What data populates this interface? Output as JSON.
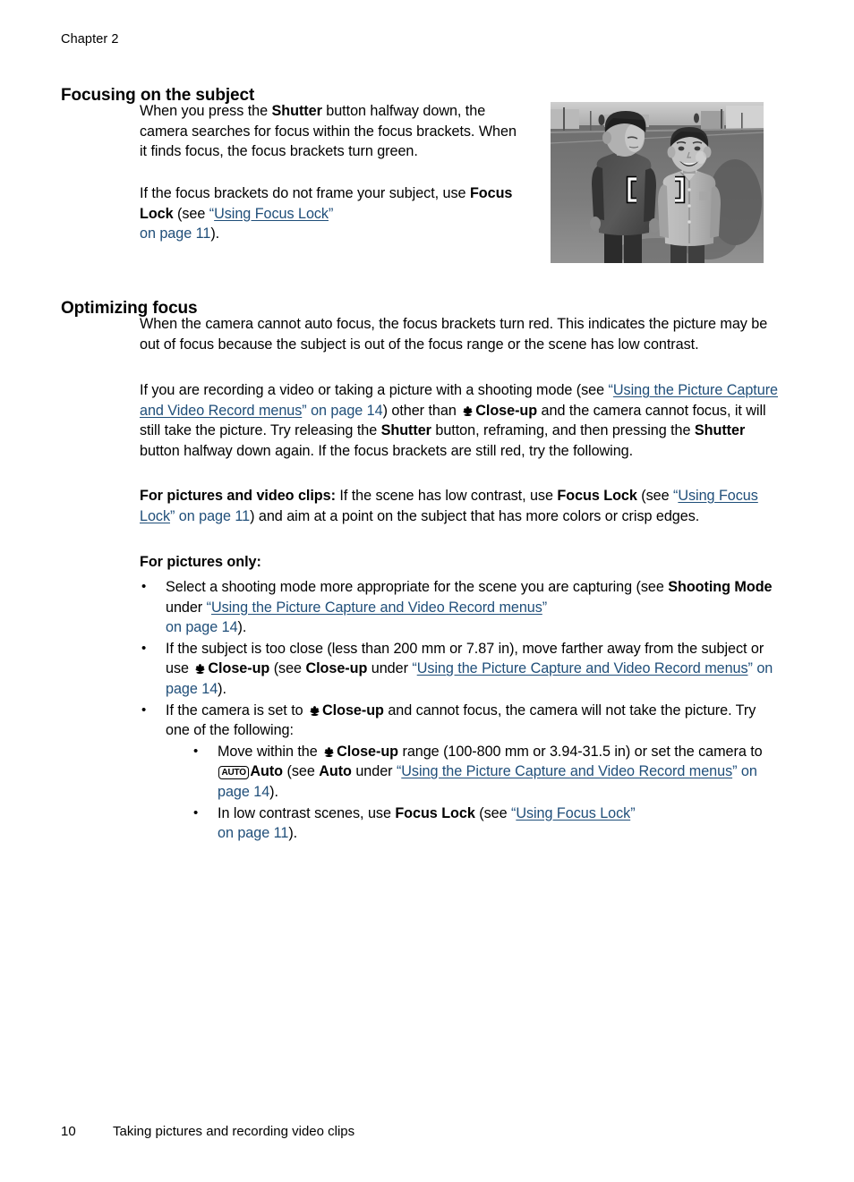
{
  "page": {
    "chapter_header": "Chapter 2",
    "footer_page_number": "10",
    "footer_title": "Taking pictures and recording video clips"
  },
  "sections": {
    "focusing": {
      "heading": "Focusing on the subject",
      "para1_a": "When you press the ",
      "para1_shutter": "Shutter",
      "para1_b": " button halfway down, the camera searches for focus within the focus brackets. When it finds focus, the focus brackets turn green.",
      "para2_a": "If the focus brackets do not frame your subject, use ",
      "para2_focuslock": "Focus Lock",
      "para2_b": " (see ",
      "para2_quote_open": "“",
      "para2_link": "Using Focus Lock",
      "para2_quote_close": "”",
      "para2_page": "on page 11",
      "para2_end": ")."
    },
    "optimizing": {
      "heading": "Optimizing focus",
      "para1": "When the camera cannot auto focus, the focus brackets turn red. This indicates the picture may be out of focus because the subject is out of the focus range or the scene has low contrast.",
      "para2_a": "If you are recording a video or taking a picture with a shooting mode (see ",
      "para2_quote_open": "“",
      "para2_link": "Using the Picture Capture and Video Record menus",
      "para2_quote_close": "”",
      "para2_page": " on page 14",
      "para2_b": ") other than ",
      "para2_closeup": "Close-up",
      "para2_c": " and the camera cannot focus, it will still take the picture. Try releasing the ",
      "para2_shutter1": "Shutter",
      "para2_d": " button, reframing, and then pressing the ",
      "para2_shutter2": "Shutter",
      "para2_e": " button halfway down again. If the focus brackets are still red, try the following.",
      "para3_label": "For pictures and video clips:",
      "para3_a": " If the scene has low contrast, use ",
      "para3_focuslock": "Focus Lock",
      "para3_b": " (see ",
      "para3_quote_open": "“",
      "para3_link": "Using Focus Lock",
      "para3_quote_close": "”",
      "para3_page": " on page 11",
      "para3_c": ") and aim at a point on the subject that has more colors or crisp edges.",
      "para4_label": "For pictures only:"
    }
  },
  "bullets": [
    {
      "bullet": "•",
      "a": "Select a shooting mode more appropriate for the scene you are capturing (see ",
      "bold1": "Shooting Mode",
      "b": " under ",
      "quote_open": "“",
      "link": "Using the Picture Capture and Video Record menus",
      "quote_close": "”",
      "page": "on page 14",
      "end": ")."
    },
    {
      "bullet": "•",
      "a": "If the subject is too close (less than 200 mm or 7.87 in), move farther away from the subject or use ",
      "closeup1": "Close-up",
      "b": " (see ",
      "closeup2": "Close-up",
      "c": " under ",
      "quote_open": "“",
      "link": "Using the Picture Capture and Video Record menus",
      "quote_close": "”",
      "page": " on page 14",
      "end": ")."
    },
    {
      "bullet": "•",
      "a": "If the camera is set to ",
      "closeup1": "Close-up",
      "b": " and cannot focus, the camera will not take the picture. Try one of the following:",
      "sub": [
        {
          "bullet": "•",
          "a": "Move within the ",
          "closeup1": "Close-up",
          "b": " range (100-800 mm or 3.94-31.5 in) or set the camera to ",
          "auto_icon_label": "AUTO",
          "auto_bold": "Auto",
          "c": " (see ",
          "auto_bold2": "Auto",
          "d": " under ",
          "quote_open": "“",
          "link": "Using the Picture Capture and Video Record menus",
          "quote_close": "”",
          "page": " on page 14",
          "end": ")."
        },
        {
          "bullet": "•",
          "a": "In low contrast scenes, use ",
          "focuslock": "Focus Lock",
          "b": " (see ",
          "quote_open": "“",
          "link": "Using Focus Lock",
          "quote_close": "”",
          "page": "on page 11",
          "end": ")."
        }
      ]
    }
  ],
  "photo": {
    "alt": "Black and white photo of two boys standing on a suburban road with focus brackets overlaid",
    "focus_bracket_color": "#ffffff",
    "focus_bracket_outline": "#000000"
  },
  "colors": {
    "link": "#1F4E79",
    "text": "#000000",
    "background": "#ffffff"
  },
  "icons": {
    "closeup": "closeup-flower-icon",
    "auto": "auto-mode-icon"
  }
}
